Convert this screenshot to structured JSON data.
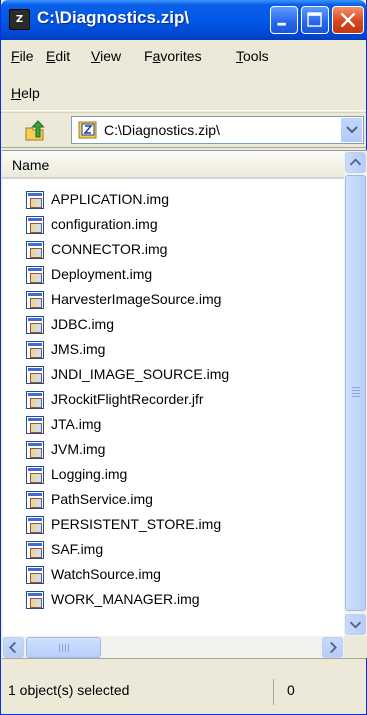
{
  "window": {
    "title": "C:\\Diagnostics.zip\\",
    "title_icon": "zip-icon",
    "title_icon_text": "Z"
  },
  "menu": {
    "items": [
      {
        "label": "File",
        "accel": "F",
        "rest": "ile"
      },
      {
        "label": "Edit",
        "accel": "E",
        "rest": "dit"
      },
      {
        "label": "View",
        "accel": "V",
        "rest": "iew"
      },
      {
        "label": "Favorites",
        "accel": "a",
        "pre": "F",
        "rest": "vorites"
      },
      {
        "label": "Tools",
        "accel": "T",
        "rest": "ools"
      },
      {
        "label": "Help",
        "accel": "H",
        "rest": "elp"
      }
    ]
  },
  "address": {
    "value": "C:\\Diagnostics.zip\\",
    "up_icon": "folder-up-icon",
    "field_icon": "zip-icon"
  },
  "list": {
    "column_header": "Name",
    "files": [
      "APPLICATION.img",
      "configuration.img",
      "CONNECTOR.img",
      "Deployment.img",
      "HarvesterImageSource.img",
      "JDBC.img",
      "JMS.img",
      "JNDI_IMAGE_SOURCE.img",
      "JRockitFlightRecorder.jfr",
      "JTA.img",
      "JVM.img",
      "Logging.img",
      "PathService.img",
      "PERSISTENT_STORE.img",
      "SAF.img",
      "WatchSource.img",
      "WORK_MANAGER.img"
    ]
  },
  "status": {
    "left": "1 object(s) selected",
    "right": "0"
  },
  "colors": {
    "titlebar": "#0058e6",
    "close_button": "#d9451b",
    "window_face": "#ece9d8"
  }
}
